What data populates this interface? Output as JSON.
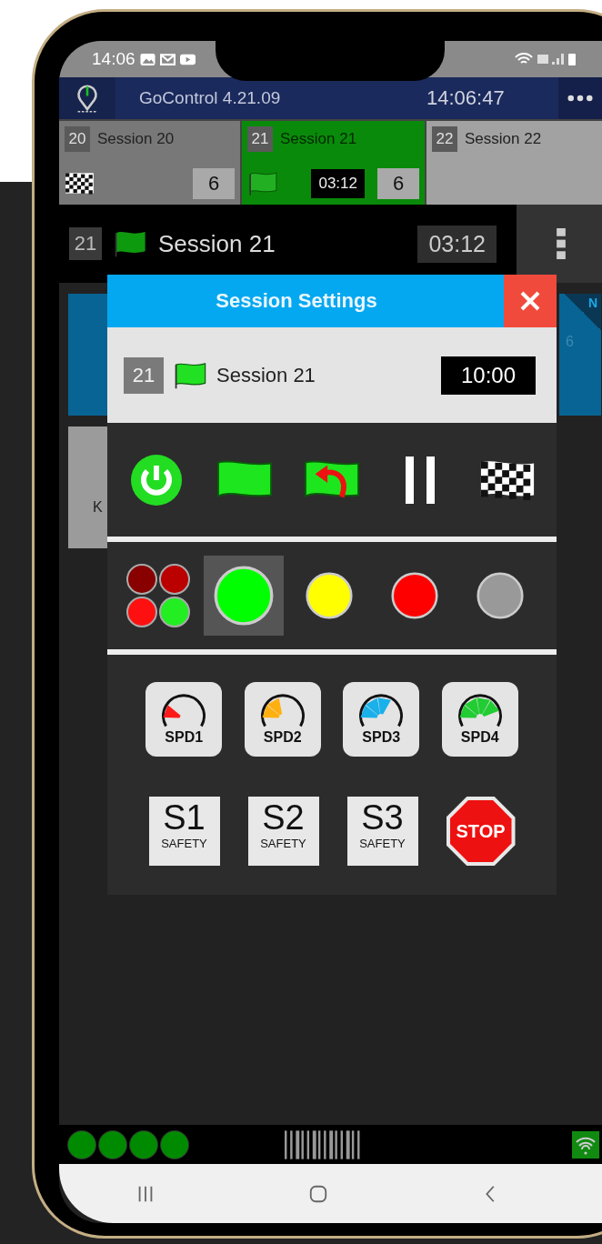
{
  "status_bar": {
    "time": "14:06"
  },
  "app_bar": {
    "title": "GoControl 4.21.09",
    "clock": "14:06:47"
  },
  "session_tabs": [
    {
      "number": "20",
      "name": "Session 20",
      "flag": {
        "kind": "checkered"
      },
      "count": "6",
      "selected": false
    },
    {
      "number": "21",
      "name": "Session 21",
      "flag": {
        "kind": "green"
      },
      "timer": "03:12",
      "count": "6",
      "selected": true
    },
    {
      "number": "22",
      "name": "Session 22",
      "selected": false
    }
  ],
  "session_header": {
    "number": "21",
    "flag": {
      "kind": "green"
    },
    "name": "Session 21",
    "timer": "03:12"
  },
  "background_cards": {
    "corner_badge": "N",
    "blue_card_value": "6",
    "grey_card_text": "K"
  },
  "dialog": {
    "title": "Session Settings",
    "session": {
      "number": "21",
      "flag": {
        "kind": "green"
      },
      "name": "Session 21",
      "duration": "10:00"
    },
    "actions": [
      {
        "kind": "power"
      },
      {
        "kind": "green_flag"
      },
      {
        "kind": "restart"
      },
      {
        "kind": "pause"
      },
      {
        "kind": "finish"
      }
    ],
    "lights": [
      {
        "kind": "multi",
        "selected": false
      },
      {
        "kind": "single",
        "color": "#00ff00",
        "selected": true
      },
      {
        "kind": "single",
        "color": "#ffff00",
        "selected": false
      },
      {
        "kind": "single",
        "color": "#ff0000",
        "selected": false
      },
      {
        "kind": "single",
        "color": "#999999",
        "selected": false
      }
    ],
    "speed_buttons": [
      {
        "label": "SPD1",
        "color": "#ff1a1a"
      },
      {
        "label": "SPD2",
        "color": "#ffb010"
      },
      {
        "label": "SPD3",
        "color": "#1ab0ea"
      },
      {
        "label": "SPD4",
        "color": "#22cc33"
      }
    ],
    "safety_buttons": [
      {
        "kind": "safety",
        "label": "S1",
        "caption": "SAFETY"
      },
      {
        "kind": "safety",
        "label": "S2",
        "caption": "SAFETY"
      },
      {
        "kind": "safety",
        "label": "S3",
        "caption": "SAFETY"
      },
      {
        "kind": "stop",
        "label": "STOP"
      }
    ]
  },
  "bottom_bar": {
    "indicators": [
      {
        "on": true
      },
      {
        "on": true
      },
      {
        "on": true
      },
      {
        "on": true
      }
    ]
  }
}
